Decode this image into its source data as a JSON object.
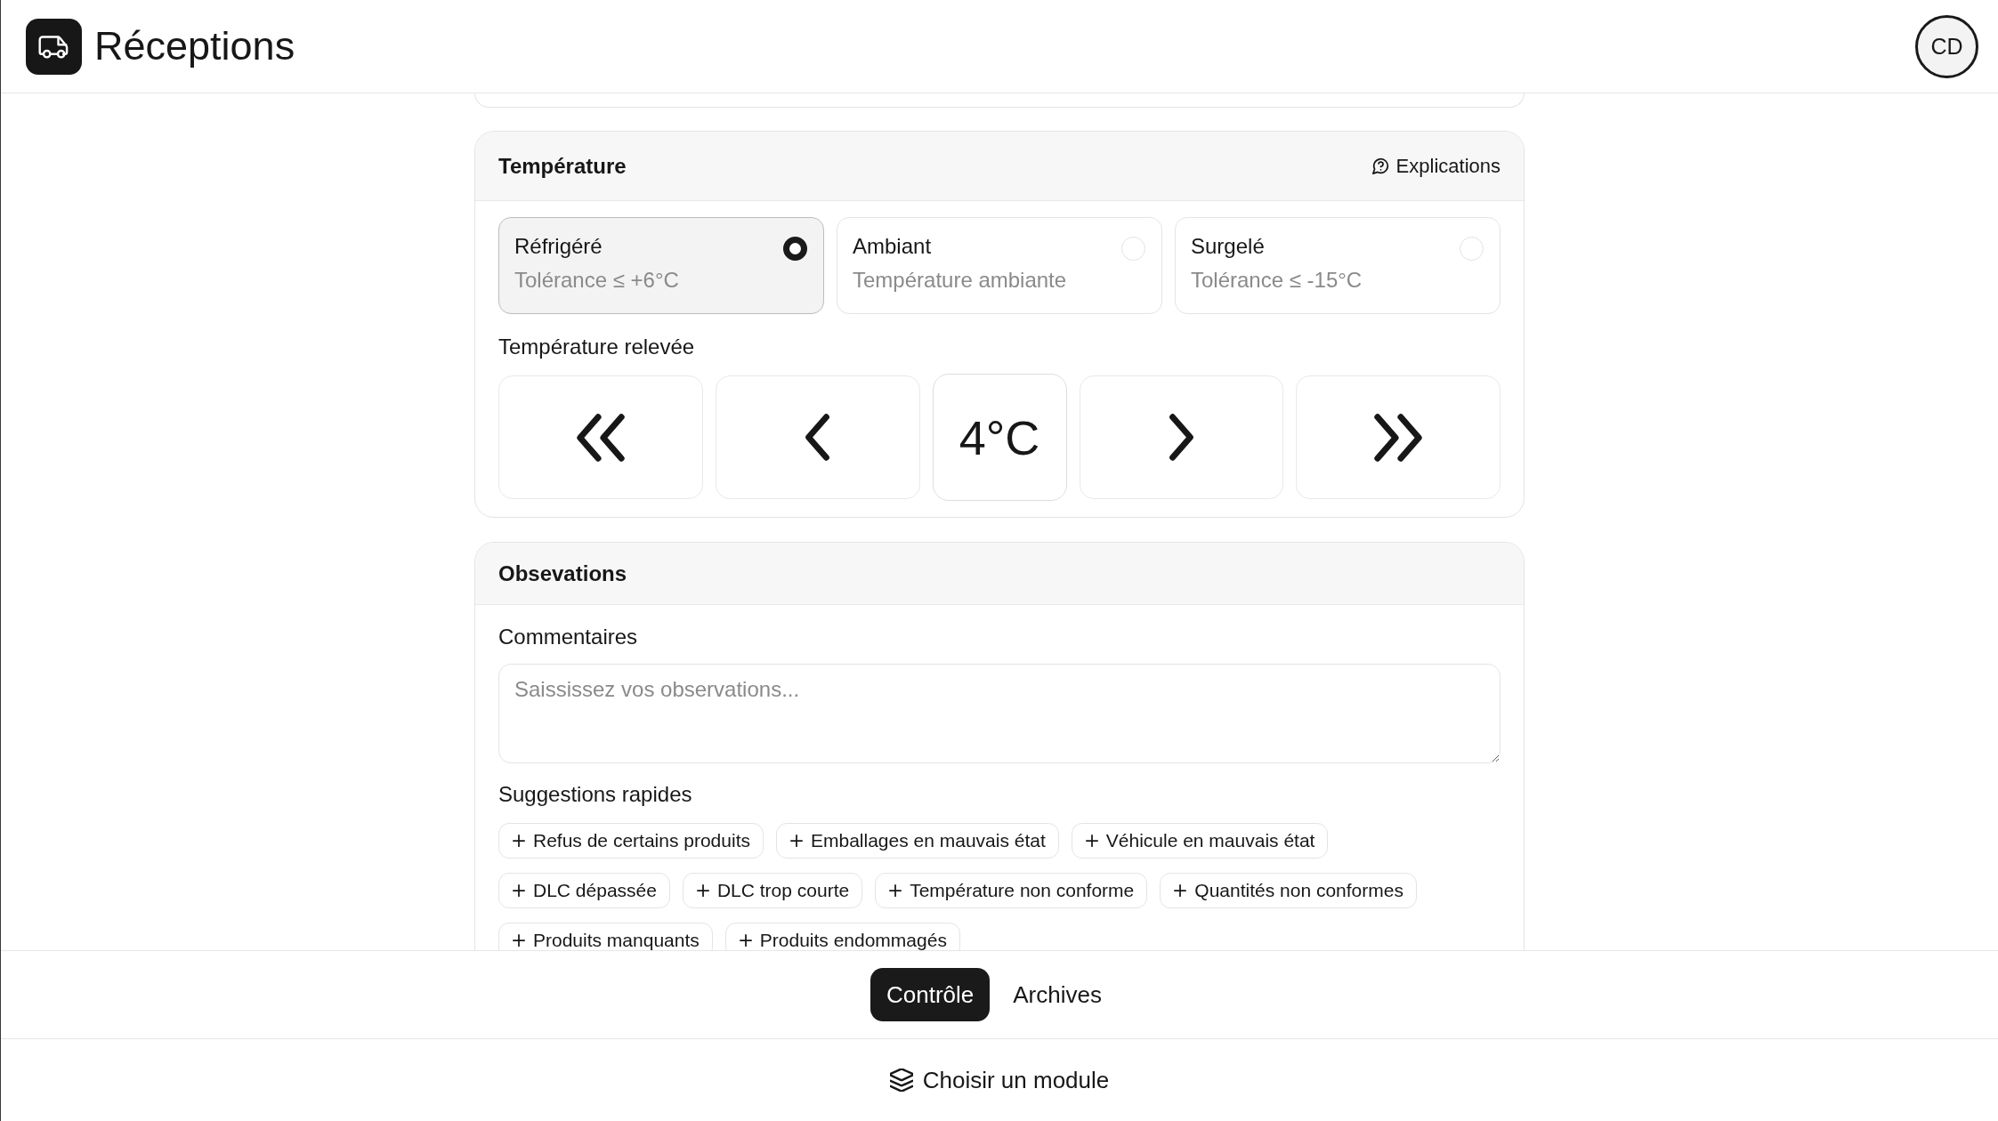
{
  "header": {
    "title": "Réceptions",
    "avatar": "CD"
  },
  "temperature": {
    "title": "Température",
    "help_link": "Explications",
    "modes": [
      {
        "label": "Réfrigéré",
        "description": "Tolérance ≤ +6°C",
        "selected": true
      },
      {
        "label": "Ambiant",
        "description": "Température ambiante",
        "selected": false
      },
      {
        "label": "Surgelé",
        "description": "Tolérance ≤ -15°C",
        "selected": false
      }
    ],
    "reading_label": "Température relevée",
    "stepper": {
      "value": "4°C"
    }
  },
  "observations": {
    "title": "Obsevations",
    "comments_label": "Commentaires",
    "comments_field": {
      "placeholder": "Saississez vos observations..."
    },
    "suggestions_label": "Suggestions rapides",
    "suggestions": [
      "Refus de certains produits",
      "Emballages en mauvais état",
      "Véhicule en mauvais état",
      "DLC dépassée",
      "DLC trop courte",
      "Température non conforme",
      "Quantités non conformes",
      "Produits manquants",
      "Produits endommagés"
    ]
  },
  "tabs": [
    {
      "label": "Contrôle",
      "selected": true
    },
    {
      "label": "Archives",
      "selected": false
    }
  ],
  "module_button": "Choisir un module"
}
